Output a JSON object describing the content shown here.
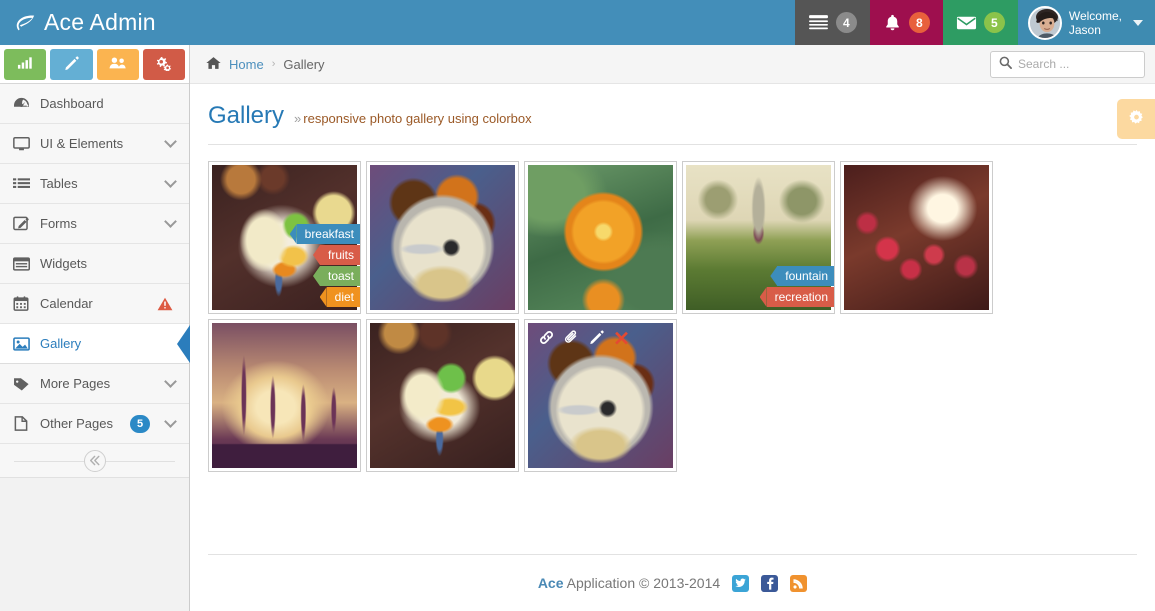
{
  "brand": {
    "title": "Ace Admin",
    "logo_icon": "leaf-icon"
  },
  "navbar": {
    "items": [
      {
        "name": "tasks",
        "icon": "tasks-icon",
        "badge": "4",
        "badge_color": "#8B8B8B",
        "bg": "#555555"
      },
      {
        "name": "notifications",
        "icon": "bell-icon",
        "badge": "8",
        "badge_color": "#E8603C",
        "bg": "#9E0F4E"
      },
      {
        "name": "messages",
        "icon": "envelope-icon",
        "badge": "5",
        "badge_color": "#8BC34A",
        "bg": "#2E9C63"
      }
    ],
    "user": {
      "greeting": "Welcome,",
      "name": "Jason",
      "avatar_icon": "user-avatar",
      "caret_icon": "chevron-down-icon"
    }
  },
  "sidebar": {
    "shortcuts": [
      {
        "name": "shortcut-charts",
        "icon": "bar-chart-icon",
        "color": "#7DBC5C"
      },
      {
        "name": "shortcut-edit",
        "icon": "pencil-icon",
        "color": "#64AFD4"
      },
      {
        "name": "shortcut-users",
        "icon": "group-icon",
        "color": "#FBB450"
      },
      {
        "name": "shortcut-settings",
        "icon": "cogs-icon",
        "color": "#D15B47"
      }
    ],
    "items": [
      {
        "label": "Dashboard",
        "icon": "dashboard-icon",
        "active": false,
        "caret": false,
        "badge": null,
        "warn": false
      },
      {
        "label": "UI & Elements",
        "icon": "desktop-icon",
        "active": false,
        "caret": true,
        "badge": null,
        "warn": false
      },
      {
        "label": "Tables",
        "icon": "list-icon",
        "active": false,
        "caret": true,
        "badge": null,
        "warn": false
      },
      {
        "label": "Forms",
        "icon": "form-edit-icon",
        "active": false,
        "caret": true,
        "badge": null,
        "warn": false
      },
      {
        "label": "Widgets",
        "icon": "widget-icon",
        "active": false,
        "caret": false,
        "badge": null,
        "warn": false
      },
      {
        "label": "Calendar",
        "icon": "calendar-icon",
        "active": false,
        "caret": false,
        "badge": null,
        "warn": true
      },
      {
        "label": "Gallery",
        "icon": "image-icon",
        "active": true,
        "caret": false,
        "badge": null,
        "warn": false
      },
      {
        "label": "More Pages",
        "icon": "tag-icon",
        "active": false,
        "caret": true,
        "badge": null,
        "warn": false
      },
      {
        "label": "Other Pages",
        "icon": "file-icon",
        "active": false,
        "caret": true,
        "badge": "5",
        "warn": false
      }
    ],
    "collapse_icon": "double-chevron-left-icon"
  },
  "breadcrumb": {
    "home_icon": "home-icon",
    "home": "Home",
    "separator": "›",
    "current": "Gallery"
  },
  "search": {
    "placeholder": "Search ...",
    "value": "",
    "icon": "search-icon"
  },
  "page": {
    "title": "Gallery",
    "subtitle_marker": "»",
    "subtitle": "responsive photo gallery using colorbox",
    "settings_icon": "gear-icon"
  },
  "gallery": {
    "hover_tools": [
      {
        "name": "link-icon",
        "glyph": "🔗"
      },
      {
        "name": "paperclip-icon",
        "glyph": "📎"
      },
      {
        "name": "pencil-icon",
        "glyph": "✎"
      },
      {
        "name": "remove-icon",
        "glyph": "✖"
      }
    ],
    "items": [
      {
        "id": "breakfast-plate",
        "photo_class": "ph-breakfast",
        "tags": [
          {
            "label": "breakfast",
            "color_class": "tag-blue",
            "color": "#3C8DBC"
          },
          {
            "label": "fruits",
            "color_class": "tag-red",
            "color": "#D85C48"
          },
          {
            "label": "toast",
            "color_class": "tag-green",
            "color": "#7AAE5C"
          },
          {
            "label": "diet",
            "color_class": "tag-orange",
            "color": "#F0921F"
          }
        ],
        "tools": false
      },
      {
        "id": "indian-thali",
        "photo_class": "ph-thali",
        "tags": [],
        "tools": false
      },
      {
        "id": "orange-flower",
        "photo_class": "ph-flower",
        "tags": [],
        "tools": false
      },
      {
        "id": "park-fountain",
        "photo_class": "ph-fountain",
        "tags": [
          {
            "label": "fountain",
            "color_class": "tag-blue",
            "color": "#3C8DBC"
          },
          {
            "label": "recreation",
            "color_class": "tag-red",
            "color": "#D85C48"
          }
        ],
        "tools": false
      },
      {
        "id": "roses-sunlight",
        "photo_class": "ph-roses",
        "tags": [],
        "tools": false
      },
      {
        "id": "sunset-plants",
        "photo_class": "ph-sunset",
        "tags": [],
        "tools": false
      },
      {
        "id": "breakfast-plate-2",
        "photo_class": "ph-breakfast2",
        "tags": [],
        "tools": false
      },
      {
        "id": "indian-thali-2",
        "photo_class": "ph-thali2",
        "tags": [],
        "tools": true
      }
    ]
  },
  "footer": {
    "brand": "Ace",
    "text": "Application © 2013-2014",
    "social": [
      {
        "name": "twitter-icon",
        "color": "#3BA4D6"
      },
      {
        "name": "facebook-icon",
        "color": "#3B5998"
      },
      {
        "name": "rss-icon",
        "color": "#F0922F"
      }
    ]
  },
  "colors": {
    "brand_blue": "#438EB9",
    "accent": "#2B7DBC",
    "link": "#4C8FBD"
  }
}
